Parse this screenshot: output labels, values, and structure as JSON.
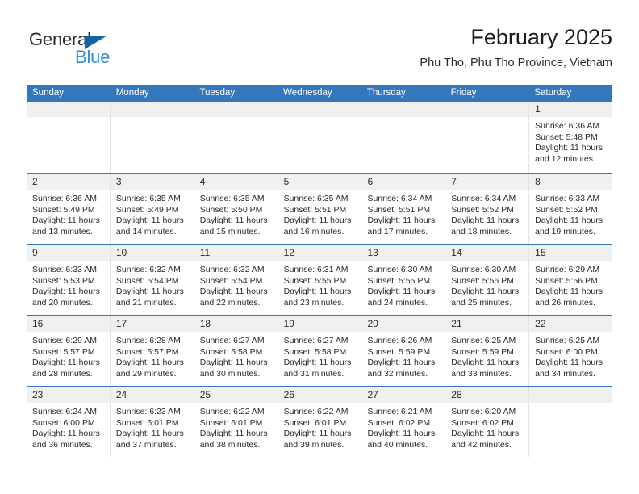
{
  "brand": {
    "name_dark": "General",
    "name_blue": "Blue",
    "triangle_color": "#1064a8",
    "blue_color": "#2e8fd6"
  },
  "header": {
    "title": "February 2025",
    "subtitle": "Phu Tho, Phu Tho Province, Vietnam"
  },
  "theme": {
    "header_bar": "#3477bb",
    "daynum_band": "#f0f0f0",
    "row_divider": "#3477bb",
    "cell_divider": "#e4e4e4",
    "text": "#2b2b2b"
  },
  "weekdays": [
    "Sunday",
    "Monday",
    "Tuesday",
    "Wednesday",
    "Thursday",
    "Friday",
    "Saturday"
  ],
  "labels": {
    "sunrise_prefix": "Sunrise:",
    "sunset_prefix": "Sunset:",
    "daylight_prefix": "Daylight:"
  },
  "weeks": [
    [
      {
        "day": "",
        "sunrise": "",
        "sunset": "",
        "daylight_1": "",
        "daylight_2": ""
      },
      {
        "day": "",
        "sunrise": "",
        "sunset": "",
        "daylight_1": "",
        "daylight_2": ""
      },
      {
        "day": "",
        "sunrise": "",
        "sunset": "",
        "daylight_1": "",
        "daylight_2": ""
      },
      {
        "day": "",
        "sunrise": "",
        "sunset": "",
        "daylight_1": "",
        "daylight_2": ""
      },
      {
        "day": "",
        "sunrise": "",
        "sunset": "",
        "daylight_1": "",
        "daylight_2": ""
      },
      {
        "day": "",
        "sunrise": "",
        "sunset": "",
        "daylight_1": "",
        "daylight_2": ""
      },
      {
        "day": "1",
        "sunrise": "Sunrise: 6:36 AM",
        "sunset": "Sunset: 5:48 PM",
        "daylight_1": "Daylight: 11 hours",
        "daylight_2": "and 12 minutes."
      }
    ],
    [
      {
        "day": "2",
        "sunrise": "Sunrise: 6:36 AM",
        "sunset": "Sunset: 5:49 PM",
        "daylight_1": "Daylight: 11 hours",
        "daylight_2": "and 13 minutes."
      },
      {
        "day": "3",
        "sunrise": "Sunrise: 6:35 AM",
        "sunset": "Sunset: 5:49 PM",
        "daylight_1": "Daylight: 11 hours",
        "daylight_2": "and 14 minutes."
      },
      {
        "day": "4",
        "sunrise": "Sunrise: 6:35 AM",
        "sunset": "Sunset: 5:50 PM",
        "daylight_1": "Daylight: 11 hours",
        "daylight_2": "and 15 minutes."
      },
      {
        "day": "5",
        "sunrise": "Sunrise: 6:35 AM",
        "sunset": "Sunset: 5:51 PM",
        "daylight_1": "Daylight: 11 hours",
        "daylight_2": "and 16 minutes."
      },
      {
        "day": "6",
        "sunrise": "Sunrise: 6:34 AM",
        "sunset": "Sunset: 5:51 PM",
        "daylight_1": "Daylight: 11 hours",
        "daylight_2": "and 17 minutes."
      },
      {
        "day": "7",
        "sunrise": "Sunrise: 6:34 AM",
        "sunset": "Sunset: 5:52 PM",
        "daylight_1": "Daylight: 11 hours",
        "daylight_2": "and 18 minutes."
      },
      {
        "day": "8",
        "sunrise": "Sunrise: 6:33 AM",
        "sunset": "Sunset: 5:52 PM",
        "daylight_1": "Daylight: 11 hours",
        "daylight_2": "and 19 minutes."
      }
    ],
    [
      {
        "day": "9",
        "sunrise": "Sunrise: 6:33 AM",
        "sunset": "Sunset: 5:53 PM",
        "daylight_1": "Daylight: 11 hours",
        "daylight_2": "and 20 minutes."
      },
      {
        "day": "10",
        "sunrise": "Sunrise: 6:32 AM",
        "sunset": "Sunset: 5:54 PM",
        "daylight_1": "Daylight: 11 hours",
        "daylight_2": "and 21 minutes."
      },
      {
        "day": "11",
        "sunrise": "Sunrise: 6:32 AM",
        "sunset": "Sunset: 5:54 PM",
        "daylight_1": "Daylight: 11 hours",
        "daylight_2": "and 22 minutes."
      },
      {
        "day": "12",
        "sunrise": "Sunrise: 6:31 AM",
        "sunset": "Sunset: 5:55 PM",
        "daylight_1": "Daylight: 11 hours",
        "daylight_2": "and 23 minutes."
      },
      {
        "day": "13",
        "sunrise": "Sunrise: 6:30 AM",
        "sunset": "Sunset: 5:55 PM",
        "daylight_1": "Daylight: 11 hours",
        "daylight_2": "and 24 minutes."
      },
      {
        "day": "14",
        "sunrise": "Sunrise: 6:30 AM",
        "sunset": "Sunset: 5:56 PM",
        "daylight_1": "Daylight: 11 hours",
        "daylight_2": "and 25 minutes."
      },
      {
        "day": "15",
        "sunrise": "Sunrise: 6:29 AM",
        "sunset": "Sunset: 5:56 PM",
        "daylight_1": "Daylight: 11 hours",
        "daylight_2": "and 26 minutes."
      }
    ],
    [
      {
        "day": "16",
        "sunrise": "Sunrise: 6:29 AM",
        "sunset": "Sunset: 5:57 PM",
        "daylight_1": "Daylight: 11 hours",
        "daylight_2": "and 28 minutes."
      },
      {
        "day": "17",
        "sunrise": "Sunrise: 6:28 AM",
        "sunset": "Sunset: 5:57 PM",
        "daylight_1": "Daylight: 11 hours",
        "daylight_2": "and 29 minutes."
      },
      {
        "day": "18",
        "sunrise": "Sunrise: 6:27 AM",
        "sunset": "Sunset: 5:58 PM",
        "daylight_1": "Daylight: 11 hours",
        "daylight_2": "and 30 minutes."
      },
      {
        "day": "19",
        "sunrise": "Sunrise: 6:27 AM",
        "sunset": "Sunset: 5:58 PM",
        "daylight_1": "Daylight: 11 hours",
        "daylight_2": "and 31 minutes."
      },
      {
        "day": "20",
        "sunrise": "Sunrise: 6:26 AM",
        "sunset": "Sunset: 5:59 PM",
        "daylight_1": "Daylight: 11 hours",
        "daylight_2": "and 32 minutes."
      },
      {
        "day": "21",
        "sunrise": "Sunrise: 6:25 AM",
        "sunset": "Sunset: 5:59 PM",
        "daylight_1": "Daylight: 11 hours",
        "daylight_2": "and 33 minutes."
      },
      {
        "day": "22",
        "sunrise": "Sunrise: 6:25 AM",
        "sunset": "Sunset: 6:00 PM",
        "daylight_1": "Daylight: 11 hours",
        "daylight_2": "and 34 minutes."
      }
    ],
    [
      {
        "day": "23",
        "sunrise": "Sunrise: 6:24 AM",
        "sunset": "Sunset: 6:00 PM",
        "daylight_1": "Daylight: 11 hours",
        "daylight_2": "and 36 minutes."
      },
      {
        "day": "24",
        "sunrise": "Sunrise: 6:23 AM",
        "sunset": "Sunset: 6:01 PM",
        "daylight_1": "Daylight: 11 hours",
        "daylight_2": "and 37 minutes."
      },
      {
        "day": "25",
        "sunrise": "Sunrise: 6:22 AM",
        "sunset": "Sunset: 6:01 PM",
        "daylight_1": "Daylight: 11 hours",
        "daylight_2": "and 38 minutes."
      },
      {
        "day": "26",
        "sunrise": "Sunrise: 6:22 AM",
        "sunset": "Sunset: 6:01 PM",
        "daylight_1": "Daylight: 11 hours",
        "daylight_2": "and 39 minutes."
      },
      {
        "day": "27",
        "sunrise": "Sunrise: 6:21 AM",
        "sunset": "Sunset: 6:02 PM",
        "daylight_1": "Daylight: 11 hours",
        "daylight_2": "and 40 minutes."
      },
      {
        "day": "28",
        "sunrise": "Sunrise: 6:20 AM",
        "sunset": "Sunset: 6:02 PM",
        "daylight_1": "Daylight: 11 hours",
        "daylight_2": "and 42 minutes."
      },
      {
        "day": "",
        "sunrise": "",
        "sunset": "",
        "daylight_1": "",
        "daylight_2": ""
      }
    ]
  ]
}
